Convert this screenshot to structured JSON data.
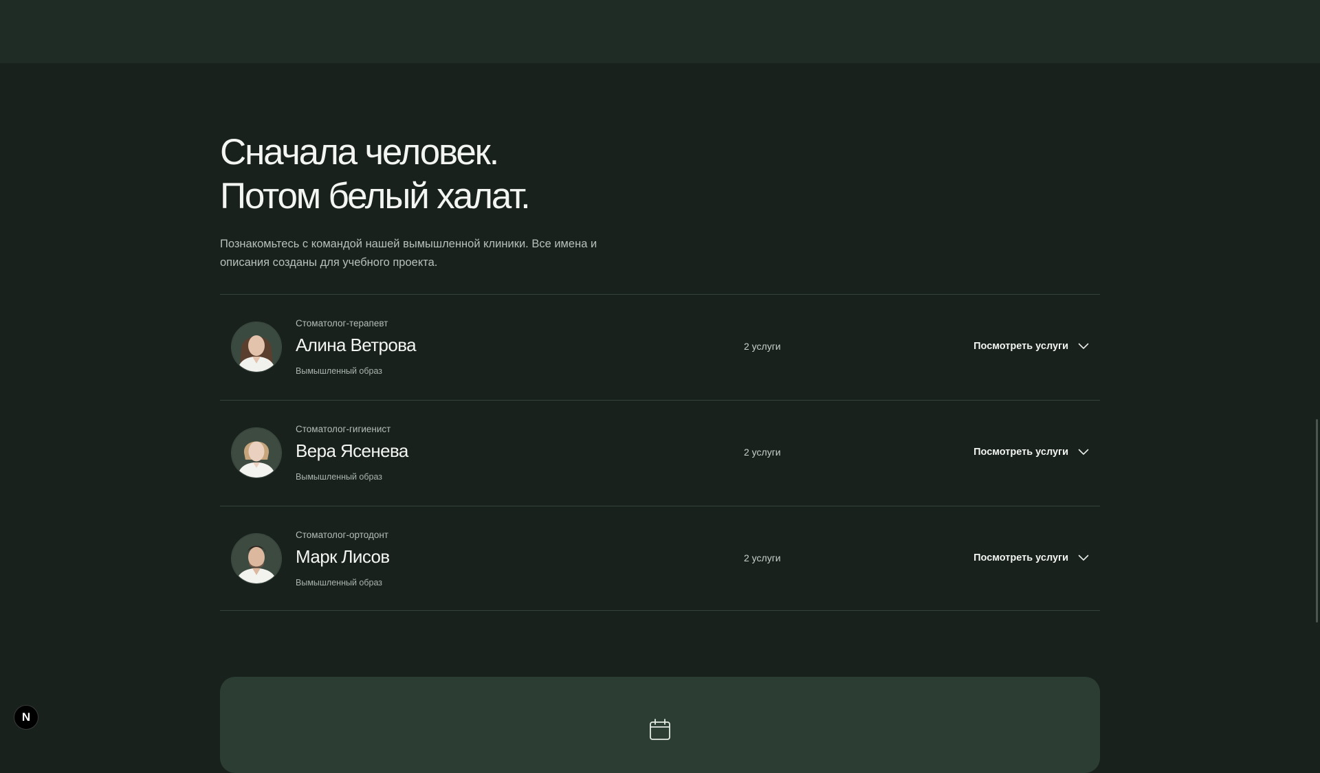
{
  "hero": {
    "title_line1": "Сначала человек.",
    "title_line2": "Потом белый халат.",
    "intro": "Познакомьтесь с командой нашей вымышленной клиники. Все имена и описания созданы для учебного проекта."
  },
  "doctors": [
    {
      "role": "Стоматолог-терапевт",
      "name": "Алина Ветрова",
      "note": "Вымышленный образ",
      "services_count": "2 услуги",
      "action_label": "Посмотреть услуги"
    },
    {
      "role": "Стоматолог-гигиенист",
      "name": "Вера Ясенева",
      "note": "Вымышленный образ",
      "services_count": "2 услуги",
      "action_label": "Посмотреть услуги"
    },
    {
      "role": "Стоматолог-ортодонт",
      "name": "Марк Лисов",
      "note": "Вымышленный образ",
      "services_count": "2 услуги",
      "action_label": "Посмотреть услуги"
    }
  ],
  "icons": {
    "expand": "chevron-down-icon",
    "booking": "calendar-icon",
    "devtools": "nextjs-logo-icon"
  },
  "badge": {
    "letter": "N"
  },
  "colors": {
    "background": "#19211d",
    "top_band": "#1f2c26",
    "card": "#2c3d33",
    "divider": "#34433b",
    "text_primary": "#f3f5f2",
    "text_secondary": "#b7c1ba"
  }
}
